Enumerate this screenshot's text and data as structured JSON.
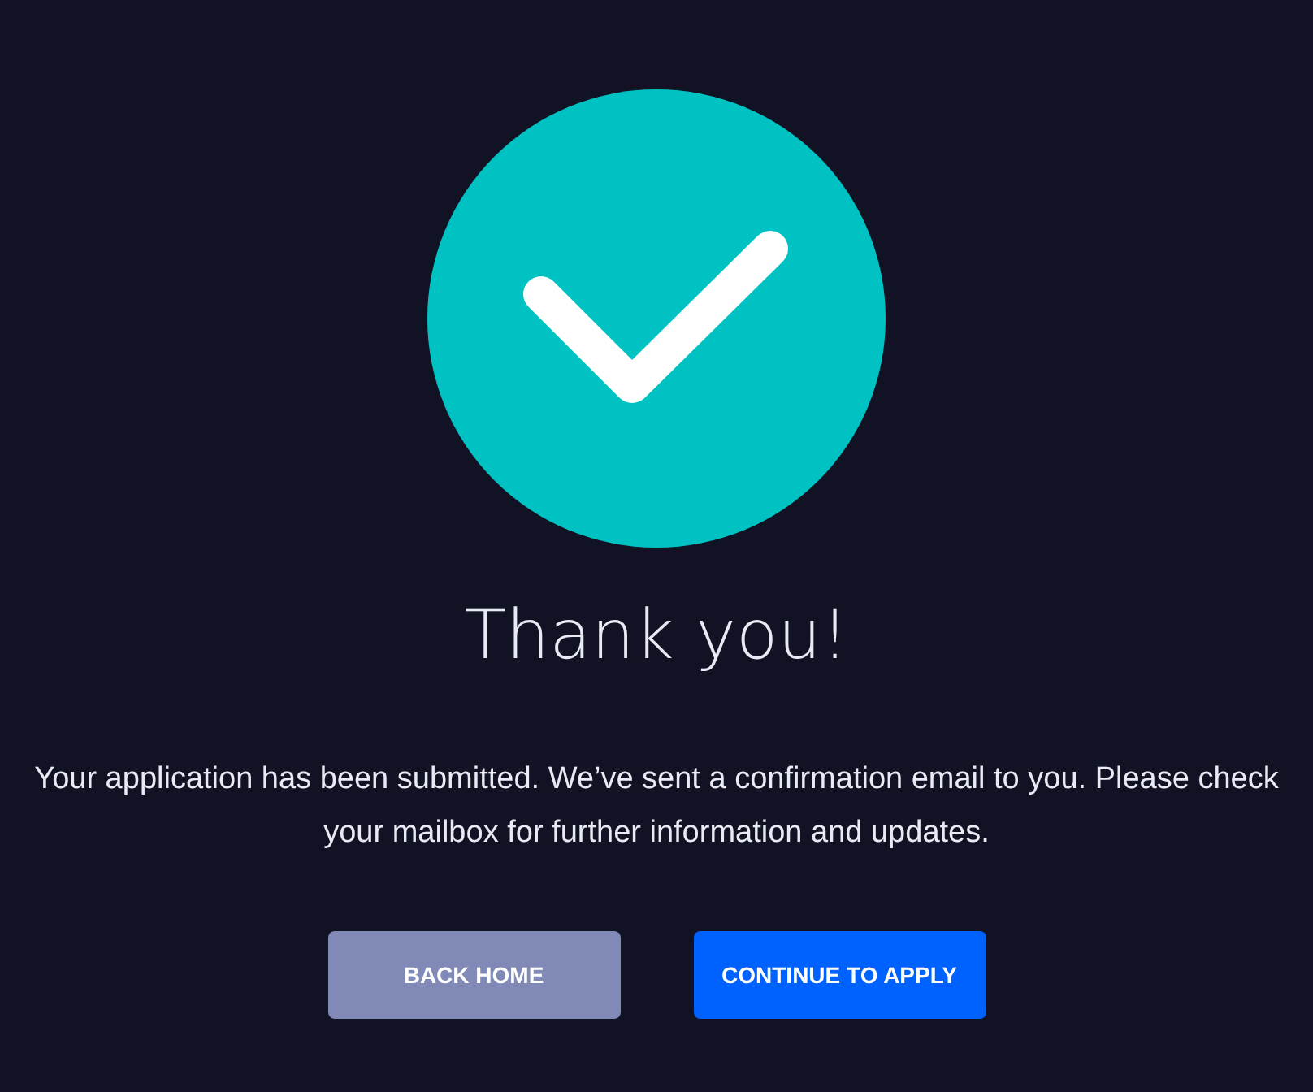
{
  "title": "Thank you!",
  "message": "Your application has been submitted. We’ve sent a confirmation email to you. Please check your mailbox for further information and updates.",
  "buttons": [
    {
      "label": "BACK HOME",
      "kind": "secondary"
    },
    {
      "label": "CONTINUE TO APPLY",
      "kind": "primary"
    }
  ]
}
